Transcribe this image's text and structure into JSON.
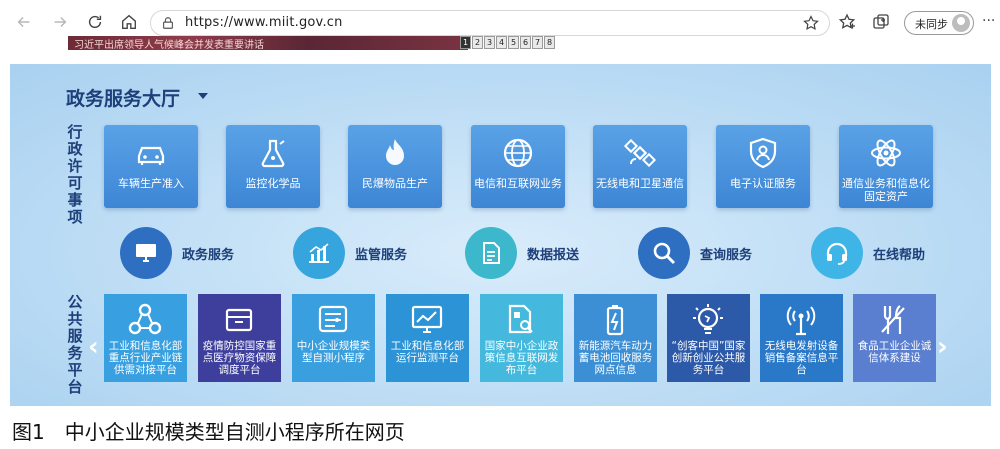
{
  "browser": {
    "url": "https://www.miit.gov.cn",
    "sync_label": "未同步"
  },
  "strip": {
    "banner_text": "习近平出席领导人气候峰会并发表重要讲话",
    "pager": [
      "1",
      "2",
      "3",
      "4",
      "5",
      "6",
      "7",
      "8"
    ]
  },
  "hall": {
    "title": "政务服务大厅",
    "admin_label": "行政许可事项",
    "admin_tiles": [
      {
        "label": "车辆生产准入",
        "icon": "car-icon"
      },
      {
        "label": "监控化学品",
        "icon": "flask-icon"
      },
      {
        "label": "民爆物品生产",
        "icon": "flame-icon"
      },
      {
        "label": "电信和互联网业务",
        "icon": "globe-icon"
      },
      {
        "label": "无线电和卫星通信",
        "icon": "satellite-icon"
      },
      {
        "label": "电子认证服务",
        "icon": "shield-user-icon"
      },
      {
        "label": "通信业务和信息化固定资产",
        "icon": "atom-icon"
      }
    ],
    "services": [
      {
        "label": "政务服务",
        "icon": "monitor-icon",
        "color": "#2f6fc2"
      },
      {
        "label": "监管服务",
        "icon": "chart-icon",
        "color": "#37a5dd"
      },
      {
        "label": "数据报送",
        "icon": "document-icon",
        "color": "#3cb7cc"
      },
      {
        "label": "查询服务",
        "icon": "search-icon",
        "color": "#2f6fc2"
      },
      {
        "label": "在线帮助",
        "icon": "headset-icon",
        "color": "#3fb4e6"
      }
    ],
    "public_label": "公共服务平台",
    "public_tiles": [
      {
        "label": "工业和信息化部重点行业产业链供需对接平台",
        "icon": "network-icon",
        "color": "#38a0e0"
      },
      {
        "label": "疫情防控国家重点医疗物资保障调度平台",
        "icon": "box-icon",
        "color": "#3e3f9c"
      },
      {
        "label": "中小企业规模类型自测小程序",
        "icon": "list-icon",
        "color": "#3a9fdf"
      },
      {
        "label": "工业和信息化部运行监测平台",
        "icon": "monitor-line-icon",
        "color": "#2c93d6"
      },
      {
        "label": "国家中小企业政策信息互联网发布平台",
        "icon": "doc-search-icon",
        "color": "#45b8dd"
      },
      {
        "label": "新能源汽车动力蓄电池回收服务网点信息",
        "icon": "battery-icon",
        "color": "#3c8fd4"
      },
      {
        "label": "“创客中国”国家创新创业公共服务平台",
        "icon": "bulb-icon",
        "color": "#2d5aa8"
      },
      {
        "label": "无线电发射设备销售备案信息平台",
        "icon": "antenna-icon",
        "color": "#2a78c8"
      },
      {
        "label": "食品工业企业诚信体系建设",
        "icon": "utensils-icon",
        "color": "#5a7fd0"
      }
    ]
  },
  "caption": "图1　中小企业规模类型自测小程序所在网页"
}
